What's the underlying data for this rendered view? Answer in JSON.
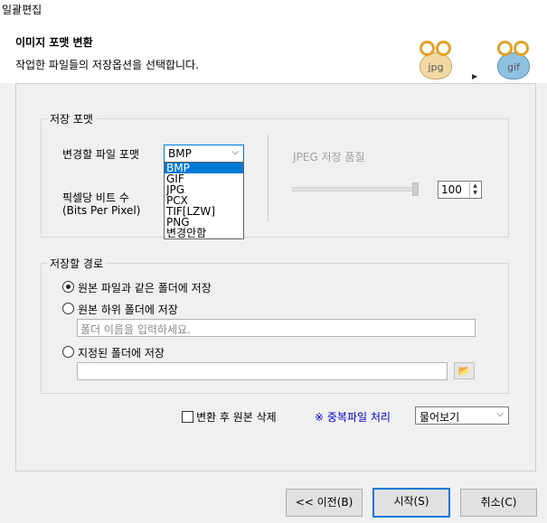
{
  "window": {
    "title": "일괄편집"
  },
  "header": {
    "title": "이미지 포맷 변환",
    "subtitle": "작업한 파일들의 저장옵션을 선택합니다.",
    "source_format": "jpg",
    "target_format": "gif"
  },
  "save_format": {
    "legend": "저장 포맷",
    "format_label": "변경할 파일 포맷",
    "format_value": "BMP",
    "format_options": [
      "BMP",
      "GIF",
      "JPG",
      "PCX",
      "TIF[LZW]",
      "PNG",
      "변경안함"
    ],
    "bits_label_1": "픽셀당 비트 수",
    "bits_label_2": "(Bits Per Pixel)",
    "jpeg_quality_label": "JPEG 저장 품질",
    "jpeg_quality_value": "100",
    "jpeg_quality_fraction": 1.0
  },
  "save_path": {
    "legend": "저장할 경로",
    "option_same": "원본 파일과 같은 폴더에 저장",
    "option_sub": "원본 하위 폴더에 저장",
    "sub_placeholder": "폴더 이름을 입력하세요.",
    "option_custom": "지정된 폴더에 저장",
    "custom_value": "",
    "selected": "same"
  },
  "options": {
    "delete_original_label": "변환 후 원본 삭제",
    "delete_original_checked": false,
    "duplicate_label": "※ 중복파일 처리",
    "duplicate_value": "물어보기"
  },
  "buttons": {
    "prev": "<< 이전(B)",
    "start": "시작(S)",
    "cancel": "취소(C)"
  }
}
